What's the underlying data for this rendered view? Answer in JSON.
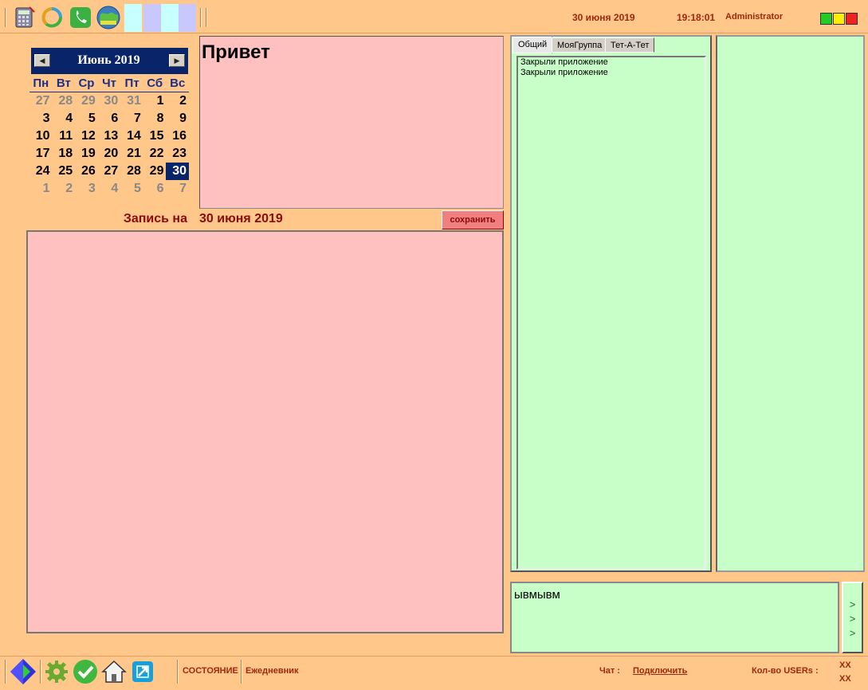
{
  "topbar": {
    "date": "30 июня 2019",
    "time": "19:18:01",
    "user": "Administrator",
    "toolbar_icons": [
      "calculator-icon",
      "recycle-icon",
      "phone-icon",
      "globe-icon"
    ],
    "window_lights": [
      "#22cc22",
      "#ffee00",
      "#ee2222"
    ]
  },
  "calendar": {
    "month_title": "Июнь 2019",
    "prev_label": "◄",
    "next_label": "►",
    "weekdays": [
      "Пн",
      "Вт",
      "Ср",
      "Чт",
      "Пт",
      "Сб",
      "Вс"
    ],
    "weeks": [
      [
        {
          "d": "27",
          "o": true
        },
        {
          "d": "28",
          "o": true
        },
        {
          "d": "29",
          "o": true
        },
        {
          "d": "30",
          "o": true
        },
        {
          "d": "31",
          "o": true
        },
        {
          "d": "1"
        },
        {
          "d": "2"
        }
      ],
      [
        {
          "d": "3"
        },
        {
          "d": "4"
        },
        {
          "d": "5"
        },
        {
          "d": "6"
        },
        {
          "d": "7"
        },
        {
          "d": "8"
        },
        {
          "d": "9"
        }
      ],
      [
        {
          "d": "10"
        },
        {
          "d": "11"
        },
        {
          "d": "12"
        },
        {
          "d": "13"
        },
        {
          "d": "14"
        },
        {
          "d": "15"
        },
        {
          "d": "16"
        }
      ],
      [
        {
          "d": "17"
        },
        {
          "d": "18"
        },
        {
          "d": "19"
        },
        {
          "d": "20"
        },
        {
          "d": "21"
        },
        {
          "d": "22"
        },
        {
          "d": "23"
        }
      ],
      [
        {
          "d": "24"
        },
        {
          "d": "25"
        },
        {
          "d": "26"
        },
        {
          "d": "27"
        },
        {
          "d": "28"
        },
        {
          "d": "29"
        },
        {
          "d": "30",
          "sel": true
        }
      ],
      [
        {
          "d": "1",
          "o": true
        },
        {
          "d": "2",
          "o": true
        },
        {
          "d": "3",
          "o": true
        },
        {
          "d": "4",
          "o": true
        },
        {
          "d": "5",
          "o": true
        },
        {
          "d": "6",
          "o": true
        },
        {
          "d": "7",
          "o": true
        }
      ]
    ]
  },
  "note": {
    "title": "Привет",
    "entry_label": "Запись на",
    "entry_date": "30 июня 2019",
    "save_label": "сохранить"
  },
  "chat": {
    "tabs": [
      "Общий",
      "МояГруппа",
      "Тет-А-Тет"
    ],
    "messages": [
      "Закрыли приложение",
      "Закрыли приложение"
    ],
    "input_value": "ывмывм",
    "send_label": ">\n>\n>"
  },
  "bottombar": {
    "state_label": "СОСТОЯНИЕ",
    "diary_label": "Ежедневник",
    "chat_label": "Чат :",
    "connect_label": "Подключить",
    "users_label": "Кол-во USERs :",
    "users_value_1": "XX",
    "users_value_2": "XX",
    "icons": [
      "diamond-icon",
      "gear-icon",
      "checkmark-icon",
      "home-icon",
      "exit-icon"
    ]
  }
}
